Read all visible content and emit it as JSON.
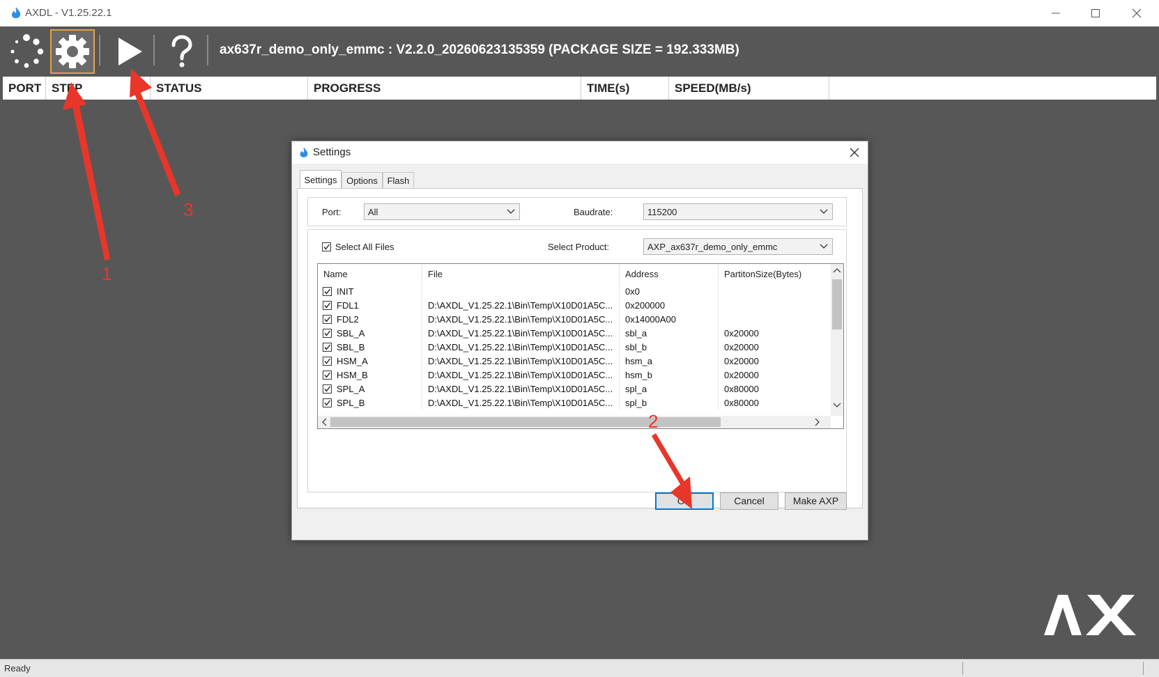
{
  "window": {
    "title": "AXDL - V1.25.22.1",
    "accent_color": "#e3a24a"
  },
  "toolbar": {
    "icons": [
      "loading-icon",
      "gear-icon",
      "play-icon",
      "help-icon"
    ],
    "package_info": "ax637r_demo_only_emmc : V2.2.0_20260623135359 (PACKAGE SIZE = 192.333MB)"
  },
  "columns": [
    "PORT",
    "STEP",
    "STATUS",
    "PROGRESS",
    "TIME(s)",
    "SPEED(MB/s)"
  ],
  "status_bar": {
    "text": "Ready"
  },
  "brand": {
    "logo_text": "AX"
  },
  "dialog": {
    "title": "Settings",
    "tabs": [
      "Settings",
      "Options",
      "Flash"
    ],
    "active_tab": "Settings",
    "port_label": "Port:",
    "port_value": "All",
    "baudrate_label": "Baudrate:",
    "baudrate_value": "115200",
    "select_all_label": "Select All Files",
    "select_all_checked": true,
    "product_label": "Select Product:",
    "product_value": "AXP_ax637r_demo_only_emmc",
    "file_columns": [
      "Name",
      "File",
      "Address",
      "PartitonSize(Bytes)"
    ],
    "files": [
      {
        "checked": true,
        "name": "INIT",
        "file": "",
        "address": "0x0",
        "size": ""
      },
      {
        "checked": true,
        "name": "FDL1",
        "file": "D:\\AXDL_V1.25.22.1\\Bin\\Temp\\X10D01A5C...",
        "address": "0x200000",
        "size": ""
      },
      {
        "checked": true,
        "name": "FDL2",
        "file": "D:\\AXDL_V1.25.22.1\\Bin\\Temp\\X10D01A5C...",
        "address": "0x14000A00",
        "size": ""
      },
      {
        "checked": true,
        "name": "SBL_A",
        "file": "D:\\AXDL_V1.25.22.1\\Bin\\Temp\\X10D01A5C...",
        "address": "sbl_a",
        "size": "0x20000"
      },
      {
        "checked": true,
        "name": "SBL_B",
        "file": "D:\\AXDL_V1.25.22.1\\Bin\\Temp\\X10D01A5C...",
        "address": "sbl_b",
        "size": "0x20000"
      },
      {
        "checked": true,
        "name": "HSM_A",
        "file": "D:\\AXDL_V1.25.22.1\\Bin\\Temp\\X10D01A5C...",
        "address": "hsm_a",
        "size": "0x20000"
      },
      {
        "checked": true,
        "name": "HSM_B",
        "file": "D:\\AXDL_V1.25.22.1\\Bin\\Temp\\X10D01A5C...",
        "address": "hsm_b",
        "size": "0x20000"
      },
      {
        "checked": true,
        "name": "SPL_A",
        "file": "D:\\AXDL_V1.25.22.1\\Bin\\Temp\\X10D01A5C...",
        "address": "spl_a",
        "size": "0x80000"
      },
      {
        "checked": true,
        "name": "SPL_B",
        "file": "D:\\AXDL_V1.25.22.1\\Bin\\Temp\\X10D01A5C...",
        "address": "spl_b",
        "size": "0x80000"
      }
    ],
    "buttons": {
      "ok": "OK",
      "cancel": "Cancel",
      "make_axp": "Make AXP"
    }
  },
  "annotations": {
    "color": "#e8362a",
    "labels": [
      "1",
      "2",
      "3"
    ]
  }
}
